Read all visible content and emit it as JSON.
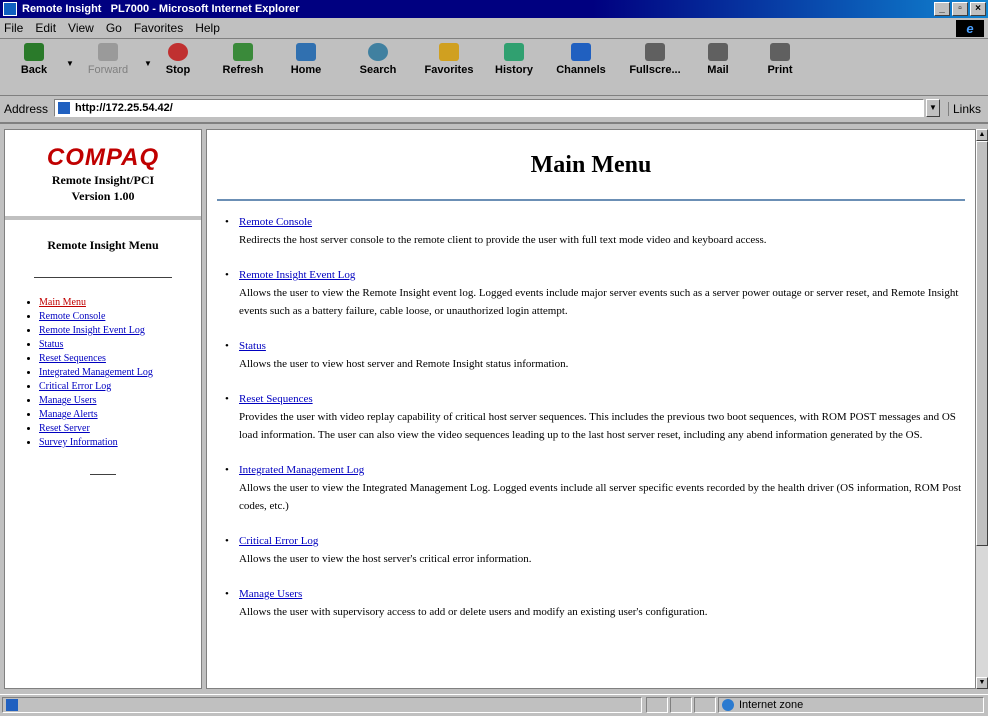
{
  "window": {
    "title": "Remote Insight   PL7000 - Microsoft Internet Explorer",
    "buttons": [
      "_",
      "▫",
      "×"
    ]
  },
  "menubar": {
    "items": [
      "File",
      "Edit",
      "View",
      "Go",
      "Favorites",
      "Help"
    ]
  },
  "toolbar": {
    "buttons": [
      {
        "label": "Back",
        "icon": "back-arrow-icon",
        "color": "#2a7a2a"
      },
      {
        "label": "Forward",
        "icon": "forward-arrow-icon",
        "color": "#9a9a9a"
      },
      {
        "label": "Stop",
        "icon": "stop-icon",
        "color": "#c03030"
      },
      {
        "label": "Refresh",
        "icon": "refresh-icon",
        "color": "#3a8a3a"
      },
      {
        "label": "Home",
        "icon": "home-icon",
        "color": "#3070b0"
      },
      {
        "label": "Search",
        "icon": "search-icon",
        "color": "#4080a0"
      },
      {
        "label": "Favorites",
        "icon": "favorites-icon",
        "color": "#d0a020"
      },
      {
        "label": "History",
        "icon": "history-icon",
        "color": "#30a070"
      },
      {
        "label": "Channels",
        "icon": "channels-icon",
        "color": "#2060c0"
      },
      {
        "label": "Fullscre...",
        "icon": "fullscreen-icon",
        "color": "#606060"
      },
      {
        "label": "Mail",
        "icon": "mail-icon",
        "color": "#606060"
      },
      {
        "label": "Print",
        "icon": "print-icon",
        "color": "#606060"
      }
    ]
  },
  "address": {
    "label": "Address",
    "url": "http://172.25.54.42/",
    "links_label": "Links"
  },
  "left": {
    "brand": "COMPAQ",
    "product": "Remote Insight/PCI",
    "version": "Version 1.00",
    "menu_title": "Remote Insight Menu",
    "items": [
      {
        "label": "Main Menu",
        "current": true
      },
      {
        "label": "Remote Console"
      },
      {
        "label": "Remote Insight Event Log"
      },
      {
        "label": "Status"
      },
      {
        "label": "Reset Sequences"
      },
      {
        "label": "Integrated Management Log"
      },
      {
        "label": "Critical Error Log"
      },
      {
        "label": "Manage Users"
      },
      {
        "label": "Manage Alerts"
      },
      {
        "label": "Reset Server"
      },
      {
        "label": "Survey Information"
      }
    ]
  },
  "main": {
    "title": "Main Menu",
    "entries": [
      {
        "link": "Remote Console",
        "desc": "Redirects the host server console to the remote client to provide the user with full text mode video and keyboard access."
      },
      {
        "link": "Remote Insight Event Log",
        "desc": "Allows the user to view the Remote Insight event log. Logged events include major server events such as a server power outage or server reset, and Remote Insight events such as a battery failure, cable loose, or unauthorized login attempt."
      },
      {
        "link": "Status",
        "desc": "Allows the user to view host server and Remote Insight status information."
      },
      {
        "link": "Reset Sequences",
        "desc": "Provides the user with video replay capability of critical host server sequences. This includes the previous two boot sequences, with ROM POST messages and OS load information. The user can also view the video sequences leading up to the last host server reset, including any abend information generated by the OS."
      },
      {
        "link": "Integrated Management Log",
        "desc": "Allows the user to view the Integrated Management Log. Logged events include all server specific events recorded by the health driver (OS information, ROM Post codes, etc.)"
      },
      {
        "link": "Critical Error Log",
        "desc": "Allows the user to view the host server's critical error information."
      },
      {
        "link": "Manage Users",
        "desc": "Allows the user with supervisory access to add or delete users and modify an existing user's configuration."
      }
    ]
  },
  "status": {
    "zone": "Internet zone"
  }
}
